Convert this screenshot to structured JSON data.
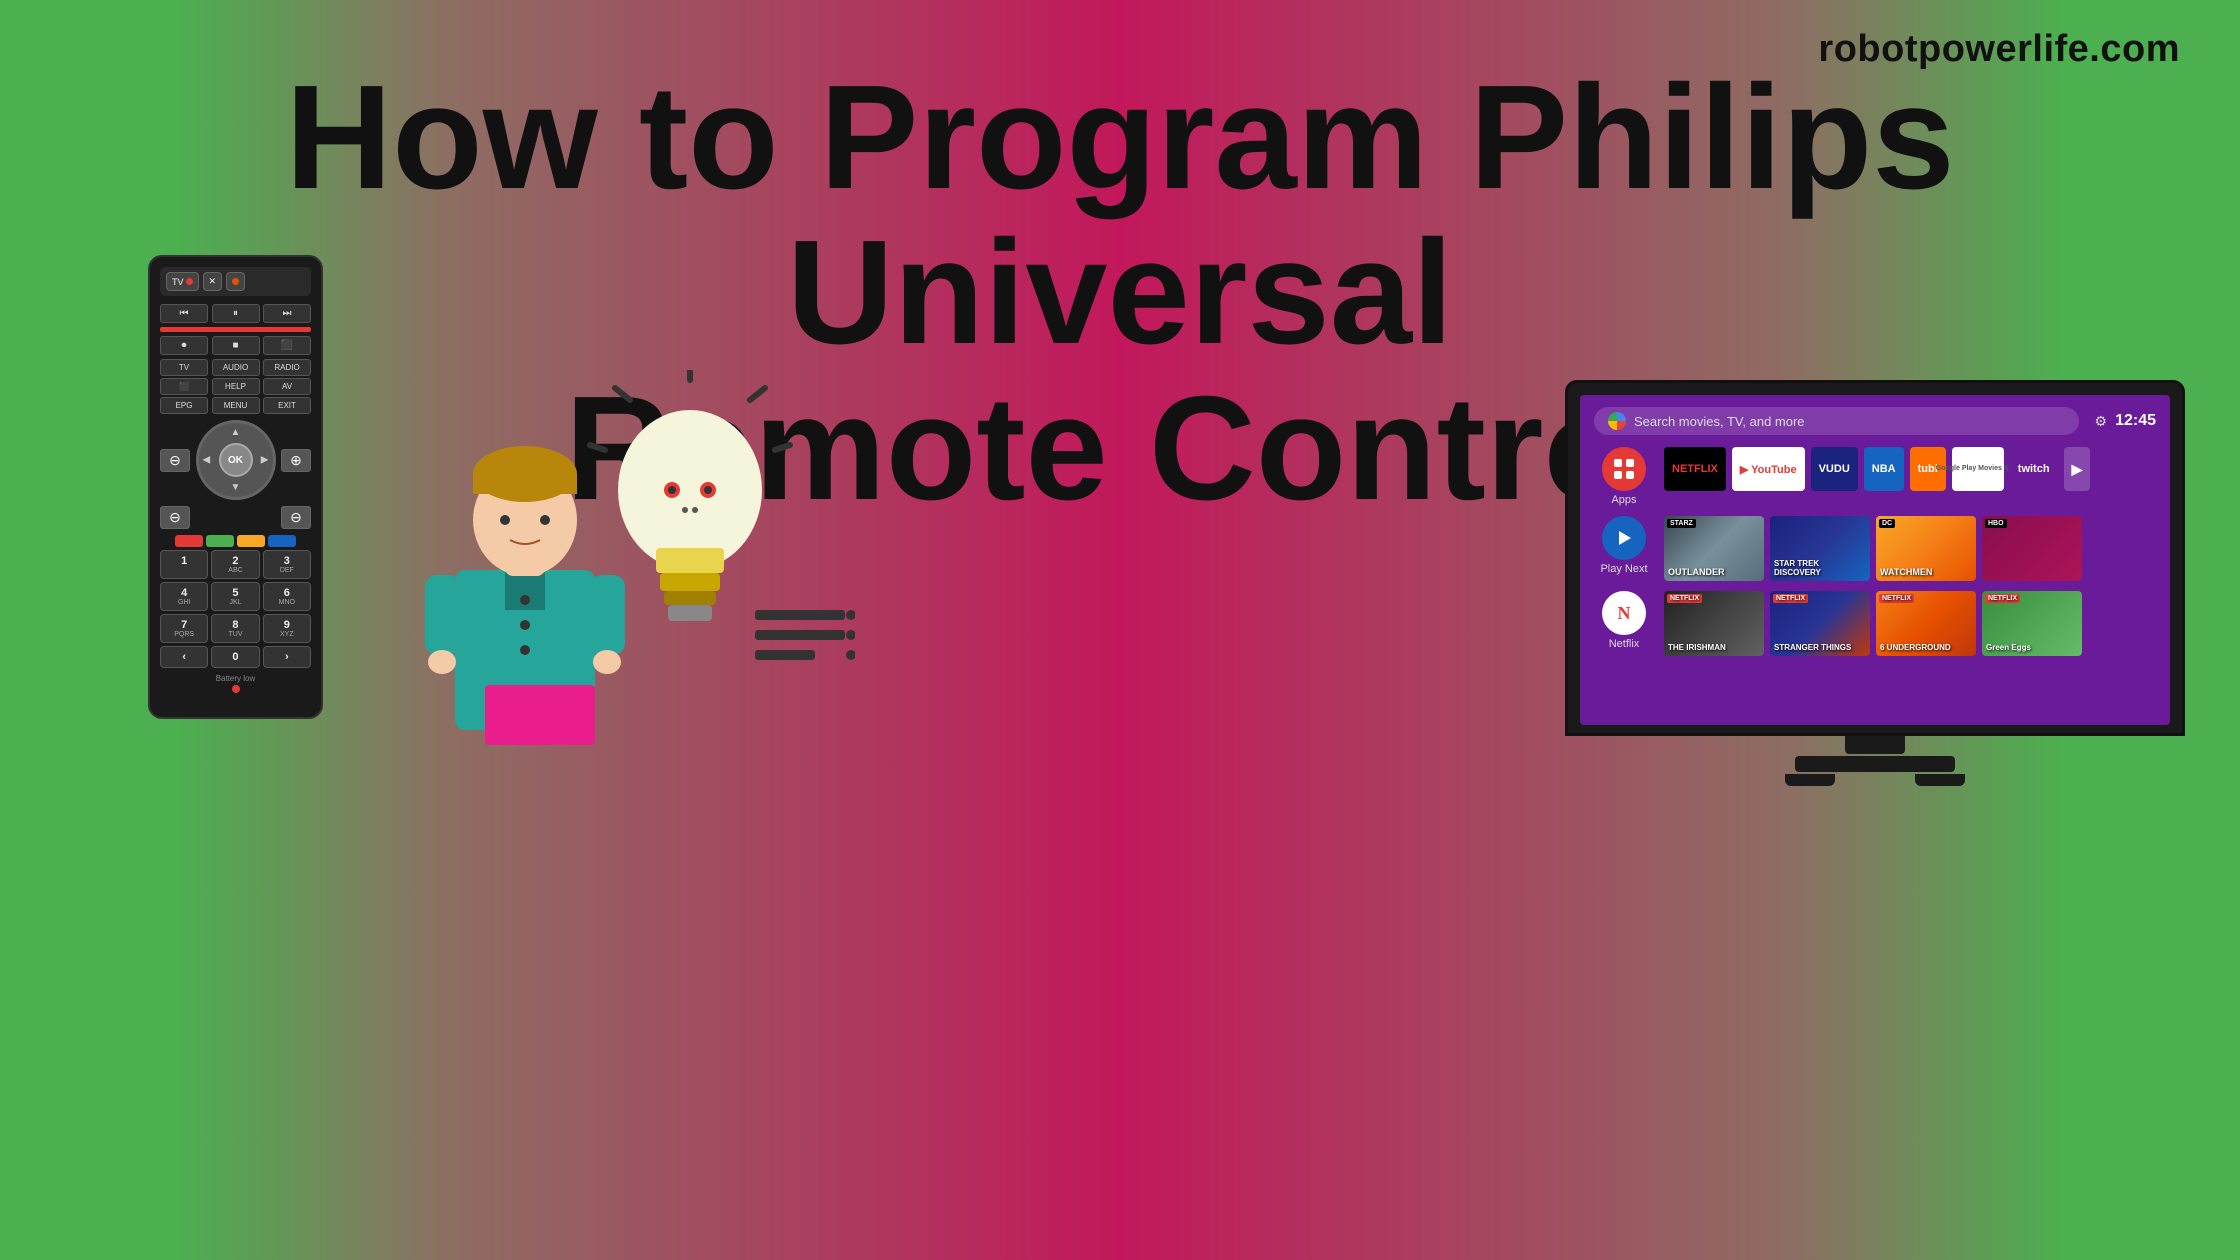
{
  "site": {
    "url": "robotpowerlife.com"
  },
  "title": {
    "line1": "How to Program Philips Universal",
    "line2": "Remote Control"
  },
  "remote": {
    "top_buttons": [
      "TV ⏻",
      "✕",
      "⏻"
    ],
    "transport": [
      "⏮",
      "⏸",
      "⏭"
    ],
    "labels": [
      "TV",
      "AUDIO",
      "RADIO",
      "⬛",
      "HELP",
      "AV",
      "EPG",
      "MENU",
      "EXIT"
    ],
    "nav_ok": "OK",
    "colors": [
      "#e53935",
      "#4caf50",
      "#f9a825",
      "#1565c0"
    ],
    "numpad": [
      "1",
      "2ABC",
      "3DEF",
      "4GHI",
      "5JKL",
      "6MNO",
      "7PQRS",
      "8TUV",
      "9XYZ",
      "<",
      "0",
      ">"
    ],
    "battery_low": "Battery low"
  },
  "tv_screen": {
    "search_placeholder": "Search movies, TV, and more",
    "time": "12:45",
    "rows": [
      {
        "label": "Apps",
        "icon_color": "#e53935",
        "apps": [
          "NETFLIX",
          "YouTube",
          "VUDU",
          "NBA",
          "tubi",
          "Google Play Movies & TV",
          "twitch",
          "▶"
        ]
      },
      {
        "label": "Play Next",
        "icon_color": "#1565c0",
        "shows": [
          "OUTLANDER",
          "STAR TREK DISCOVERY",
          "WATCHMEN",
          "HBO"
        ]
      },
      {
        "label": "Netflix",
        "icon_color": "#e53935",
        "shows": [
          "THE IRISHMAN",
          "STRANGER THINGS",
          "6 UNDERGROUND",
          "Green Eggs"
        ]
      }
    ]
  },
  "illustration": {
    "description": "Person with lightbulb idea illustration"
  }
}
